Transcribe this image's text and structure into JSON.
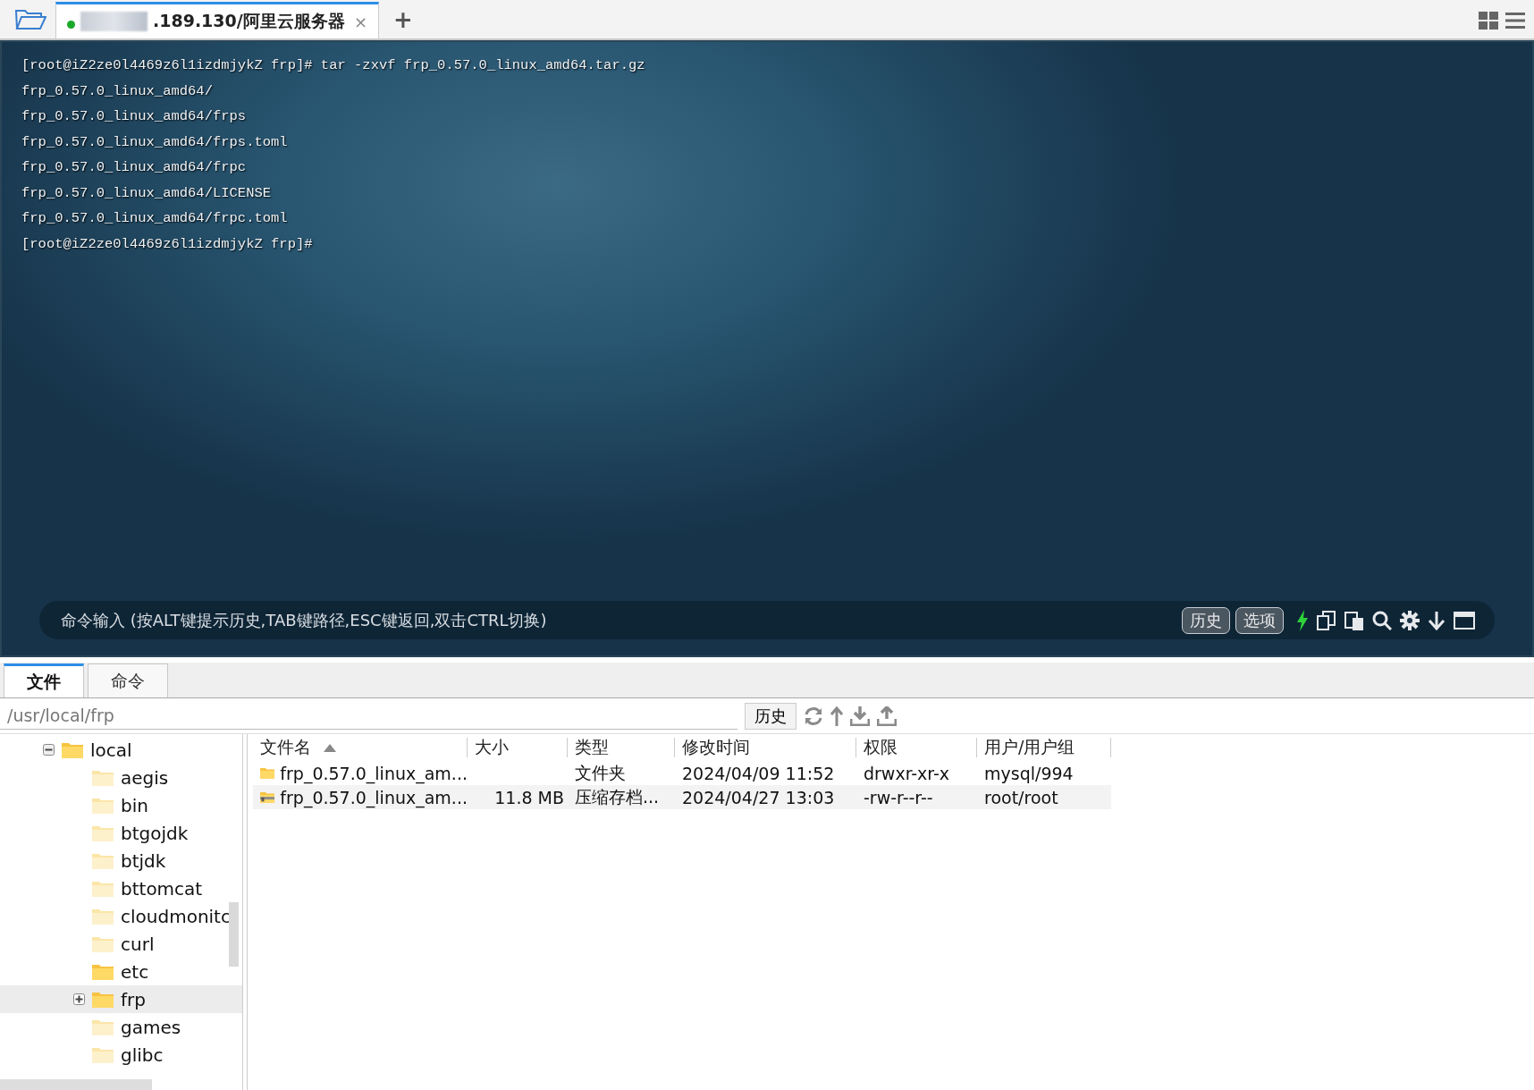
{
  "tab_bar": {
    "tabs": [
      {
        "title": ".189.130/阿里云服务器",
        "connected": true,
        "selected": true,
        "close": "×"
      }
    ],
    "add": "+"
  },
  "terminal": {
    "lines": [
      "[root@iZ2ze0l4469z6l1izdmjykZ frp]# tar -zxvf frp_0.57.0_linux_amd64.tar.gz",
      "frp_0.57.0_linux_amd64/",
      "frp_0.57.0_linux_amd64/frps",
      "frp_0.57.0_linux_amd64/frps.toml",
      "frp_0.57.0_linux_amd64/frpc",
      "frp_0.57.0_linux_amd64/LICENSE",
      "frp_0.57.0_linux_amd64/frpc.toml",
      "[root@iZ2ze0l4469z6l1izdmjykZ frp]#"
    ]
  },
  "command_bar": {
    "placeholder": "命令输入 (按ALT键提示历史,TAB键路径,ESC键返回,双击CTRL切换)",
    "buttons": [
      "历史",
      "选项"
    ]
  },
  "panel_tabs": [
    {
      "label": "文件",
      "selected": true
    },
    {
      "label": "命令",
      "selected": false
    }
  ],
  "path_bar": {
    "value": "/usr/local/frp",
    "history_button": "历史"
  },
  "tree": [
    {
      "name": "local",
      "expandable": true,
      "expanded": true,
      "faded": false,
      "selected": false,
      "children": [
        {
          "name": "aegis",
          "expandable": false,
          "expanded": false,
          "faded": true,
          "selected": false
        },
        {
          "name": "bin",
          "expandable": false,
          "expanded": false,
          "faded": true,
          "selected": false
        },
        {
          "name": "btgojdk",
          "expandable": false,
          "expanded": false,
          "faded": true,
          "selected": false
        },
        {
          "name": "btjdk",
          "expandable": false,
          "expanded": false,
          "faded": true,
          "selected": false
        },
        {
          "name": "bttomcat",
          "expandable": false,
          "expanded": false,
          "faded": true,
          "selected": false
        },
        {
          "name": "cloudmonitc",
          "expandable": false,
          "expanded": false,
          "faded": true,
          "selected": false
        },
        {
          "name": "curl",
          "expandable": false,
          "expanded": false,
          "faded": true,
          "selected": false
        },
        {
          "name": "etc",
          "expandable": false,
          "expanded": false,
          "faded": false,
          "selected": false
        },
        {
          "name": "frp",
          "expandable": true,
          "expanded": false,
          "faded": false,
          "selected": true
        },
        {
          "name": "games",
          "expandable": false,
          "expanded": false,
          "faded": true,
          "selected": false
        },
        {
          "name": "glibc",
          "expandable": false,
          "expanded": false,
          "faded": true,
          "selected": false
        }
      ]
    }
  ],
  "file_table": {
    "columns": [
      {
        "label": "文件名",
        "sorted": true
      },
      {
        "label": "大小",
        "sorted": false
      },
      {
        "label": "类型",
        "sorted": false
      },
      {
        "label": "修改时间",
        "sorted": false
      },
      {
        "label": "权限",
        "sorted": false
      },
      {
        "label": "用户/用户组",
        "sorted": false
      }
    ],
    "rows": [
      {
        "kind": "folder",
        "highlighted": false,
        "cells": [
          "frp_0.57.0_linux_am...",
          "",
          "文件夹",
          "2024/04/09 11:52",
          "drwxr-xr-x",
          "mysql/994"
        ]
      },
      {
        "kind": "archive",
        "highlighted": true,
        "cells": [
          "frp_0.57.0_linux_am...",
          "11.8 MB",
          "压缩存档...",
          "2024/04/27 13:03",
          "-rw-r--r--",
          "root/root"
        ]
      }
    ]
  }
}
